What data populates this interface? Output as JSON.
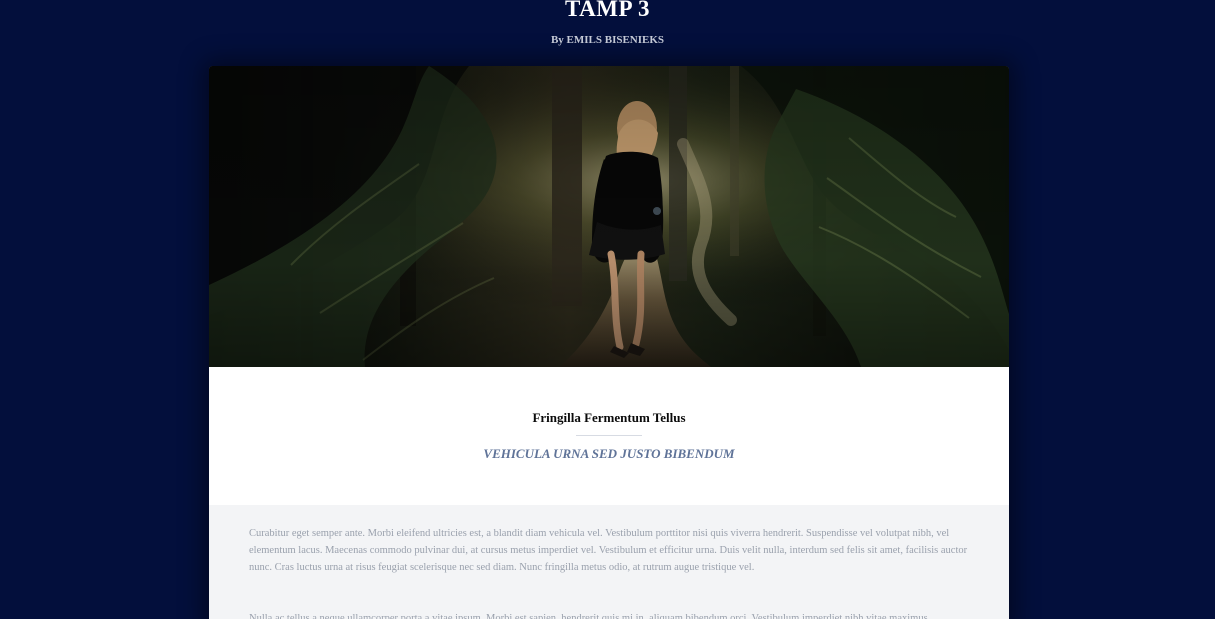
{
  "header": {
    "title": "TAMP 3",
    "byline_prefix": "By",
    "author": "EMILS BISENIEKS"
  },
  "hero": {
    "alt": "Woman walking on a forest path"
  },
  "post": {
    "title": "Fringilla Fermentum Tellus",
    "subtitle": "VEHICULA URNA SED JUSTO BIBENDUM",
    "paragraphs": [
      "Curabitur eget semper ante. Morbi eleifend ultricies est, a blandit diam vehicula vel. Vestibulum porttitor nisi quis viverra hendrerit. Suspendisse vel volutpat nibh, vel elementum lacus. Maecenas commodo pulvinar dui, at cursus metus imperdiet vel. Vestibulum et efficitur urna. Duis velit nulla, interdum sed felis sit amet, facilisis auctor nunc. Cras luctus urna at risus feugiat scelerisque nec sed diam. Nunc fringilla metus odio, at rutrum augue tristique vel.",
      "Nulla ac tellus a neque ullamcorper porta a vitae ipsum. Morbi est sapien, hendrerit quis mi in, aliquam bibendum orci. Vestibulum imperdiet nibh vitae maximus"
    ]
  },
  "colors": {
    "page_background": "#030f3c",
    "title_text": "#ffffff",
    "byline_text": "#c7ccd9",
    "subtitle_text": "#5f7398",
    "paragraph_text": "#9aa1ad"
  }
}
